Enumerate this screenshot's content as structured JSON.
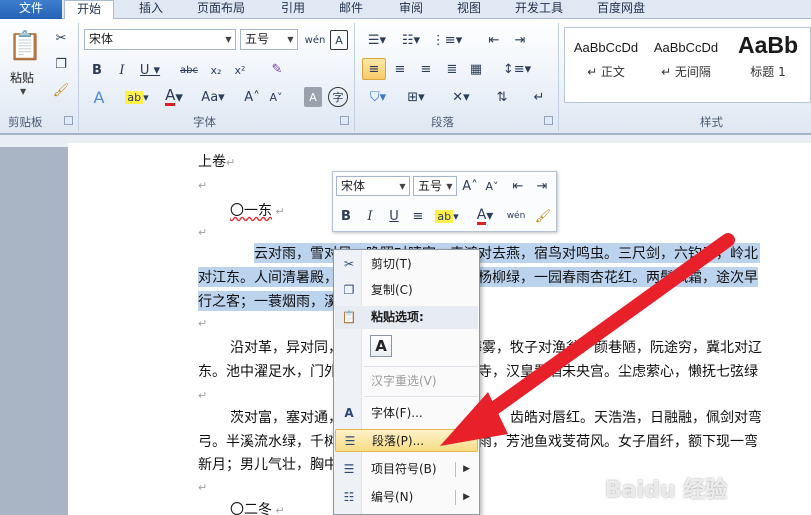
{
  "tabs": [
    "文件",
    "开始",
    "插入",
    "页面布局",
    "引用",
    "邮件",
    "审阅",
    "视图",
    "开发工具",
    "百度网盘"
  ],
  "clipboard": {
    "paste_label": "粘贴",
    "group_label": "剪贴板"
  },
  "font_group": {
    "font_name": "宋体",
    "font_size": "五号",
    "group_label": "字体"
  },
  "paragraph_group": {
    "group_label": "段落"
  },
  "styles_group": {
    "group_label": "样式",
    "items": [
      {
        "sample": "AaBbCcDd",
        "name": "↵ 正文"
      },
      {
        "sample": "AaBbCcDd",
        "name": "↵ 无间隔"
      },
      {
        "sample": "AaBb",
        "name": "标题 1"
      }
    ]
  },
  "document": {
    "lines": [
      "上卷",
      "",
      "〇一东",
      "",
      "云对雨，雪对风，晚照对晴空。来鸿对去燕，宿鸟对鸣虫。三尺剑，六钧弓，岭北",
      "对江东。人间清暑殿，天上广寒宫。两岸晓烟杨柳绿，一园春雨杏花红。两鬓风霜，途次早",
      "行之客；一蓑烟雨，溪边晚钓之翁。",
      "",
      "沿对革，异对同，白叟对黄童。江风对海雾，牧子对渔翁。颜巷陋，阮途穷，冀北对辽",
      "东。池中濯足水，门外打头风。梁帝讲经同泰寺，汉皇置酒未央宫。尘虑萦心，懒抚七弦绿",
      "",
      "茨对富，塞对通，野叟对溪童。鬓皤对眉绿，齿皓对唇红。天浩浩，日融融，佩剑对弯",
      "弓。半溪流水绿，千树落花红。野渡燕穿杨柳雨，芳池鱼戏芰荷风。女子眉纤，额下现一弯",
      "新月；男儿气壮，胸中吐万丈长虹。",
      "",
      "〇二冬"
    ]
  },
  "mini_toolbar": {
    "font_name": "宋体",
    "font_size": "五号"
  },
  "context_menu": {
    "cut": "剪切(T)",
    "copy": "复制(C)",
    "paste_options": "粘贴选项:",
    "hanzi_reselect": "汉字重选(V)",
    "font": "字体(F)...",
    "paragraph": "段落(P)...",
    "bullets": "项目符号(B)",
    "numbering": "编号(N)"
  },
  "watermark": "Baidu 经验",
  "colors": {
    "arrow": "#e8202a",
    "selection": "#bcd3ee",
    "hover": "#f8dd86"
  }
}
